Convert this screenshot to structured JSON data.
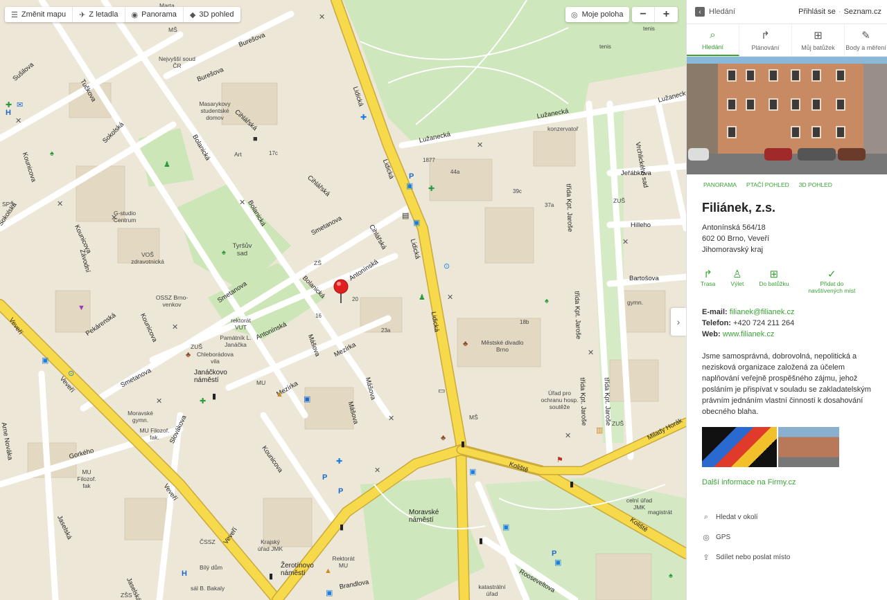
{
  "toolbar": {
    "change_map": "Změnit mapu",
    "aerial": "Z letadla",
    "panorama": "Panorama",
    "view3d": "3D pohled",
    "my_location": "Moje poloha",
    "zoom_out": "−",
    "zoom_in": "+"
  },
  "map": {
    "streets": {
      "lidicka": "Lidická",
      "lidicka2": "Lidická",
      "lidicka3": "Lidická",
      "lidicka4": "Lidická",
      "burešova": "Burešova",
      "burešova2": "Burešova",
      "cihlarska": "Cihlářská",
      "cihlarska2": "Cihlářská",
      "cihlarska3": "Cihlářská",
      "bolanicka": "Bolanická",
      "bolanicka2": "Bolanická",
      "bolanicka3": "Bolanická",
      "smetanova": "Smetanova",
      "smetanova2": "Smetanova",
      "smetanova3": "Smetanova",
      "antoninska": "Antonínská",
      "antoninska2": "Antonínská",
      "masova": "Mášova",
      "masova2": "Mášova",
      "masova3": "Mášova",
      "mezirka": "Mezírka",
      "mezirka2": "Mezírka",
      "kounicova": "Kounicova",
      "kounicova2": "Kounicova",
      "kounicova3": "Kounicova",
      "kounicova4": "Kounicova",
      "veveri": "Veveří",
      "veveri2": "Veveří",
      "veveri3": "Veveří",
      "veveri4": "Veveří",
      "pekarenska": "Pekárenská",
      "gorkeho": "Gorkého",
      "jaselska": "Jaselská",
      "jaselska2": "Jaselská",
      "slovakova": "Slovákova",
      "sokolska": "Sokolská",
      "sokolska2": "Sokolská",
      "suslova": "Sušilova",
      "tuckova": "Tučkova",
      "zavodni": "Závodní",
      "arne_novaka": "Arne Nováka",
      "luzanecka": "Lužanecká",
      "luzanecka2": "Lužanecká",
      "luzanecka3": "Lužanecká",
      "jerabkova": "Jeřábkova",
      "hilleho": "Hilleho",
      "bartosova": "Bartošova",
      "kpt1": "třída Kpt. Jaroše",
      "kpt2": "třída Kpt. Jaroše",
      "kpt3": "třída Kpt. Jaroše",
      "kpt4": "třída Kpt. Jaroše",
      "vrchlickeho": "Vrchlického sad",
      "koliste": "Koliště",
      "koliste2": "Koliště",
      "milady": "Milady Horák",
      "brandlova": "Brandlova",
      "rooseveltova": "Rooseveltova"
    },
    "labels": {
      "janackovo": "Janáčkovo náměstí",
      "moravske": "Moravské náměstí",
      "zerotinovo": "Žerotínovo náměstí",
      "tyrsuv": "Tyršův sad",
      "ossz": "OSSZ Brno-venkov",
      "rektorat_vut": "rektorát VUT",
      "pamatnik": "Památník L. Janáčka",
      "zus": "ZUŠ",
      "zus2": "ZUŠ",
      "zus3": "ZUŠ",
      "chleboradova": "Chleborádova vila",
      "mu": "MU",
      "mu_filozof": "MU Filozof. fak.",
      "mu_filozof2": "MU Filozof. fak",
      "moravska_gymn": "Moravské gymn.",
      "vos": "VOŠ zdravotnická",
      "g_studio": "G-studio Centrum",
      "masarykovy": "Masarykovy studentské domov",
      "nejvyssi_soud": "Nejvyšší soud ČR",
      "ms": "MŠ",
      "ms2": "MŠ",
      "sps": "SPŠ",
      "art": "Art",
      "konzervator": "konzervatoř",
      "divadlo": "Městské divadlo Brno",
      "urad_ochranu": "Úřad pro ochranu hosp. soutěže",
      "krajsky_urad": "Krajský úřad JMK",
      "cssz": "ČSSZ",
      "bily_dum": "Bílý dům",
      "bakaly": "sál B. Bakaly",
      "rektorat_mu": "Rektorát MU",
      "katastralni": "katastrální úřad",
      "magistrat": "magistrát",
      "ceini_urad": "celní úřad JMK",
      "gymn": "gymn.",
      "tenis": "tenis",
      "tenis2": "tenis",
      "zs": "ZŠ",
      "zss": "ZŠS",
      "marta": "Marta",
      "num_17c": "17c",
      "num_20": "20",
      "num_16": "16",
      "num_23a": "23a",
      "num_44a": "44a",
      "num_39c": "39c",
      "num_37a": "37a",
      "num_18b": "18b",
      "num_1877": "1877"
    }
  },
  "panel": {
    "back_label": "Hledání",
    "login": "Přihlásit se",
    "seznam": "Seznam.cz",
    "tabs": [
      "Hledání",
      "Plánování",
      "Můj batůžek",
      "Body a měření"
    ],
    "photo_links": [
      "PANORAMA",
      "PTAČÍ POHLED",
      "3D POHLED"
    ],
    "name": "Filiánek, z.s.",
    "address": [
      "Antonínská 564/18",
      "602 00  Brno, Veveří",
      "Jihomoravský kraj"
    ],
    "actions": [
      "Trasa",
      "Výlet",
      "Do batůžku",
      "Přidat do navštívených míst"
    ],
    "email_label": "E-mail:",
    "email": "filianek@filianek.cz",
    "phone_label": "Telefon:",
    "phone": "+420 724 211 264",
    "web_label": "Web:",
    "web": "www.filianek.cz",
    "description": "Jsme samosprávná, dobrovolná, nepolitická a nezisková organizace založená za účelem naplňování veřejně prospěšného zájmu, jehož posláním je přispívat v souladu se zakladatelským právním jednáním vlastní činností k dosahování obecného blaha.",
    "more_info": "Další informace na Firmy.cz",
    "rows": [
      "Hledat v okolí",
      "GPS",
      "Sdílet nebo poslat místo"
    ]
  },
  "colors": {
    "accent": "#3aa335",
    "main_road": "#f7d94c",
    "park": "#cde6b8",
    "pin": "#e02020"
  }
}
